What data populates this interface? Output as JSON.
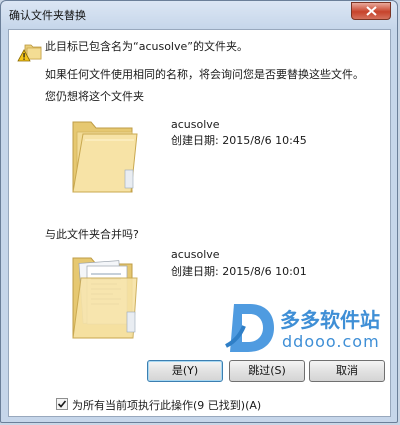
{
  "window": {
    "title": "确认文件夹替换",
    "close_icon": "close-icon"
  },
  "message": {
    "line1": "此目标已包含名为“acusolve”的文件夹。",
    "line2": "如果任何文件使用相同的名称，将会询问您是否要替换这些文件。",
    "line3": "您仍想将这个文件夹"
  },
  "existing_folder": {
    "name": "acusolve",
    "created": "创建日期: 2015/8/6 10:45"
  },
  "merge_question": "与此文件夹合并吗?",
  "new_folder": {
    "name": "acusolve",
    "created": "创建日期: 2015/8/6 10:01"
  },
  "buttons": {
    "yes": "是(Y)",
    "skip": "跳过(S)",
    "cancel": "取消"
  },
  "apply_all": {
    "label": "为所有当前项执行此操作(9 已找到)(A)",
    "checked": true
  },
  "watermark": {
    "brand_cn": "多多软件站",
    "brand_url": "ddooo.com"
  },
  "colors": {
    "accent": "#3c7fb1",
    "watermark_blue": "#3f8fd6"
  }
}
